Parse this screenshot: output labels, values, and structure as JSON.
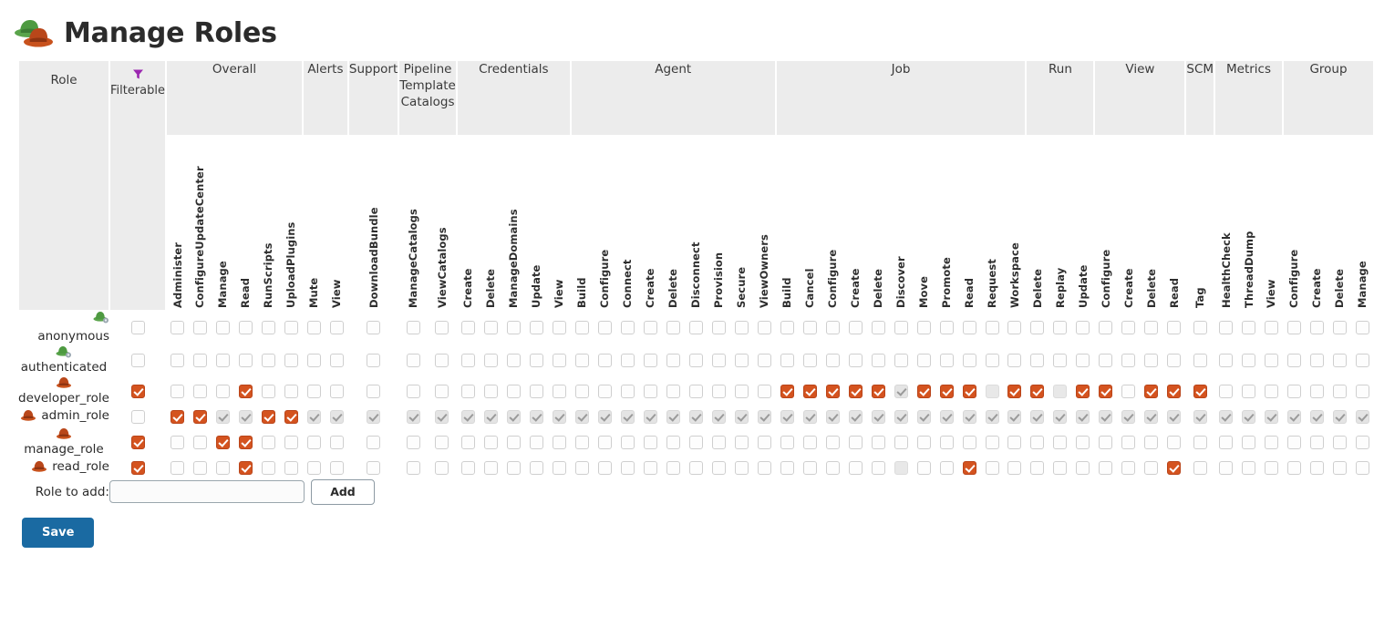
{
  "page": {
    "title": "Manage Roles",
    "icon": "hats-icon"
  },
  "table": {
    "role_column_header": "Role",
    "filterable_column": {
      "label": "Filterable",
      "icon": "funnel-icon",
      "icon_color": "#9b27b0"
    },
    "groups": [
      {
        "name": "Overall",
        "columns": [
          "Administer",
          "ConfigureUpdateCenter",
          "Manage",
          "Read",
          "RunScripts",
          "UploadPlugins"
        ]
      },
      {
        "name": "Alerts",
        "columns": [
          "Mute",
          "View"
        ]
      },
      {
        "name": "Support",
        "columns": [
          "DownloadBundle"
        ]
      },
      {
        "name": "Pipeline Template Catalogs",
        "columns": [
          "ManageCatalogs",
          "ViewCatalogs"
        ]
      },
      {
        "name": "Credentials",
        "columns": [
          "Create",
          "Delete",
          "ManageDomains",
          "Update",
          "View"
        ]
      },
      {
        "name": "Agent",
        "columns": [
          "Build",
          "Configure",
          "Connect",
          "Create",
          "Delete",
          "Disconnect",
          "Provision",
          "Secure",
          "ViewOwners"
        ]
      },
      {
        "name": "Job",
        "columns": [
          "Build",
          "Cancel",
          "Configure",
          "Create",
          "Delete",
          "Discover",
          "Move",
          "Promote",
          "Read",
          "Request",
          "Workspace"
        ]
      },
      {
        "name": "Run",
        "columns": [
          "Delete",
          "Replay",
          "Update"
        ]
      },
      {
        "name": "View",
        "columns": [
          "Configure",
          "Create",
          "Delete",
          "Read"
        ]
      },
      {
        "name": "SCM",
        "columns": [
          "Tag"
        ]
      },
      {
        "name": "Metrics",
        "columns": [
          "HealthCheck",
          "ThreadDump",
          "View"
        ]
      },
      {
        "name": "Group",
        "columns": [
          "Configure",
          "Create",
          "Delete",
          "Manage"
        ]
      }
    ],
    "rows": [
      {
        "name": "anonymous",
        "icon": "green-hat-gear-icon",
        "wrapped": false,
        "filterable": "empty",
        "cells": [
          "empty",
          "empty",
          "empty",
          "empty",
          "empty",
          "empty",
          "empty",
          "empty",
          "empty",
          "empty",
          "empty",
          "empty",
          "empty",
          "empty",
          "empty",
          "empty",
          "empty",
          "empty",
          "empty",
          "empty",
          "empty",
          "empty",
          "empty",
          "empty",
          "empty",
          "empty",
          "empty",
          "empty",
          "empty",
          "empty",
          "empty",
          "empty",
          "empty",
          "empty",
          "empty",
          "empty",
          "empty",
          "empty",
          "empty",
          "empty",
          "empty",
          "empty",
          "empty",
          "empty",
          "empty",
          "empty",
          "empty",
          "empty",
          "empty",
          "empty",
          "empty"
        ]
      },
      {
        "name": "authenticated",
        "icon": "green-hat-gear-icon",
        "wrapped": true,
        "filterable": "empty",
        "cells": [
          "empty",
          "empty",
          "empty",
          "empty",
          "empty",
          "empty",
          "empty",
          "empty",
          "empty",
          "empty",
          "empty",
          "empty",
          "empty",
          "empty",
          "empty",
          "empty",
          "empty",
          "empty",
          "empty",
          "empty",
          "empty",
          "empty",
          "empty",
          "empty",
          "empty",
          "empty",
          "empty",
          "empty",
          "empty",
          "empty",
          "empty",
          "empty",
          "empty",
          "empty",
          "empty",
          "empty",
          "empty",
          "empty",
          "empty",
          "empty",
          "empty",
          "empty",
          "empty",
          "empty",
          "empty",
          "empty",
          "empty",
          "empty",
          "empty",
          "empty",
          "empty"
        ]
      },
      {
        "name": "developer_role",
        "icon": "brown-hat-icon",
        "wrapped": true,
        "filterable": "checked",
        "cells": [
          "empty",
          "empty",
          "empty",
          "checked",
          "empty",
          "empty",
          "empty",
          "empty",
          "empty",
          "empty",
          "empty",
          "empty",
          "empty",
          "empty",
          "empty",
          "empty",
          "empty",
          "empty",
          "empty",
          "empty",
          "empty",
          "empty",
          "empty",
          "empty",
          "empty",
          "checked",
          "checked",
          "checked",
          "checked",
          "checked",
          "inherited",
          "checked",
          "checked",
          "checked",
          "disabled-blank",
          "checked",
          "checked",
          "disabled-blank",
          "checked",
          "checked",
          "empty",
          "checked",
          "checked",
          "checked",
          "empty",
          "empty",
          "empty",
          "empty",
          "empty",
          "empty",
          "empty"
        ]
      },
      {
        "name": "admin_role",
        "icon": "brown-hat-icon",
        "wrapped": false,
        "filterable": "empty",
        "cells": [
          "checked",
          "checked",
          "inherited",
          "inherited",
          "checked",
          "checked",
          "inherited",
          "inherited",
          "inherited",
          "inherited",
          "inherited",
          "inherited",
          "inherited",
          "inherited",
          "inherited",
          "inherited",
          "inherited",
          "inherited",
          "inherited",
          "inherited",
          "inherited",
          "inherited",
          "inherited",
          "inherited",
          "inherited",
          "inherited",
          "inherited",
          "inherited",
          "inherited",
          "inherited",
          "inherited",
          "inherited",
          "inherited",
          "inherited",
          "inherited",
          "inherited",
          "inherited",
          "inherited",
          "inherited",
          "inherited",
          "inherited",
          "inherited",
          "inherited",
          "inherited",
          "inherited",
          "inherited",
          "inherited",
          "inherited",
          "inherited",
          "inherited",
          "inherited"
        ]
      },
      {
        "name": "manage_role",
        "icon": "brown-hat-icon",
        "wrapped": true,
        "filterable": "checked",
        "cells": [
          "empty",
          "empty",
          "checked",
          "checked",
          "empty",
          "empty",
          "empty",
          "empty",
          "empty",
          "empty",
          "empty",
          "empty",
          "empty",
          "empty",
          "empty",
          "empty",
          "empty",
          "empty",
          "empty",
          "empty",
          "empty",
          "empty",
          "empty",
          "empty",
          "empty",
          "empty",
          "empty",
          "empty",
          "empty",
          "empty",
          "empty",
          "empty",
          "empty",
          "empty",
          "empty",
          "empty",
          "empty",
          "empty",
          "empty",
          "empty",
          "empty",
          "empty",
          "empty",
          "empty",
          "empty",
          "empty",
          "empty",
          "empty",
          "empty",
          "empty",
          "empty"
        ]
      },
      {
        "name": "read_role",
        "icon": "brown-hat-icon",
        "wrapped": false,
        "filterable": "checked",
        "cells": [
          "empty",
          "empty",
          "empty",
          "checked",
          "empty",
          "empty",
          "empty",
          "empty",
          "empty",
          "empty",
          "empty",
          "empty",
          "empty",
          "empty",
          "empty",
          "empty",
          "empty",
          "empty",
          "empty",
          "empty",
          "empty",
          "empty",
          "empty",
          "empty",
          "empty",
          "empty",
          "empty",
          "empty",
          "empty",
          "empty",
          "disabled-blank",
          "empty",
          "empty",
          "checked",
          "empty",
          "empty",
          "empty",
          "empty",
          "empty",
          "empty",
          "empty",
          "empty",
          "checked",
          "empty",
          "empty",
          "empty",
          "empty",
          "empty",
          "empty",
          "empty",
          "empty"
        ]
      }
    ]
  },
  "footer": {
    "add_label": "Role to add:",
    "add_input_value": "",
    "add_input_placeholder": "",
    "add_button": "Add",
    "save_button": "Save"
  },
  "colors": {
    "checked": "#d4531f",
    "inherited": "#e4e4e4",
    "header_bg": "#ececec",
    "save_button": "#1a6aa2",
    "funnel": "#9b27b0"
  }
}
